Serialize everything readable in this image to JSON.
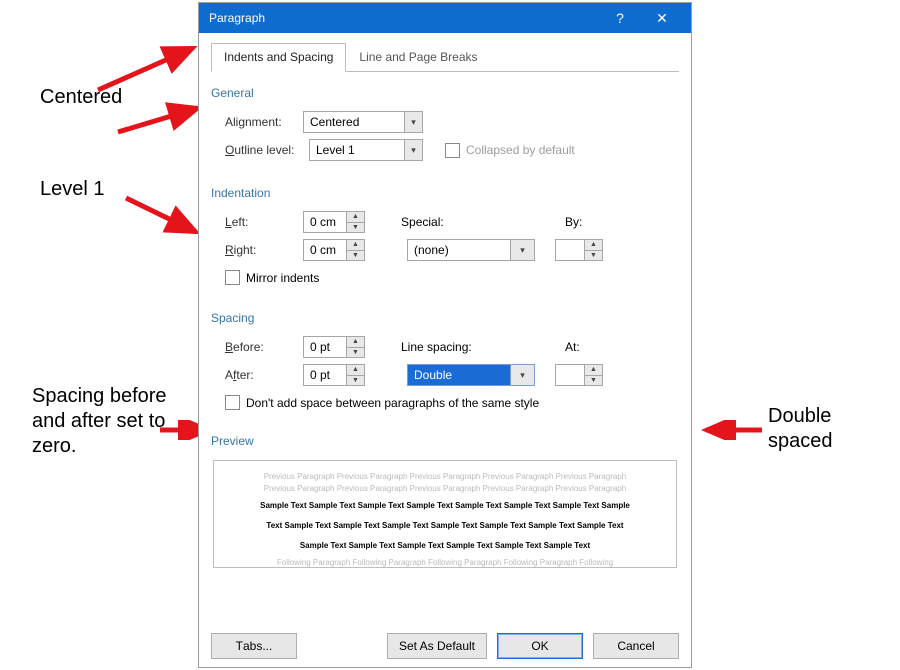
{
  "dialog": {
    "title": "Paragraph",
    "help_icon": "?",
    "close_icon": "✕"
  },
  "tabs": {
    "active": "Indents and Spacing",
    "other": "Line and Page Breaks"
  },
  "general": {
    "section": "General",
    "alignment_label": "Alignment:",
    "alignment_value": "Centered",
    "outline_label_pre": "O",
    "outline_label_post": "utline level:",
    "outline_value": "Level 1",
    "collapsed_label": "Collapsed by default"
  },
  "indentation": {
    "section": "Indentation",
    "left_label_pre": "L",
    "left_label_post": "eft:",
    "left_value": "0 cm",
    "right_label_pre": "R",
    "right_label_post": "ight:",
    "right_value": "0 cm",
    "special_label_pre": "S",
    "special_label_post": "pecial:",
    "special_value": "(none)",
    "by_label_pre": "B",
    "by_label_post": "y:",
    "by_value": "",
    "mirror_label_pre": "M",
    "mirror_label_post": "irror indents"
  },
  "spacing": {
    "section": "Spacing",
    "before_label_pre": "B",
    "before_label_post": "efore:",
    "before_value": "0 pt",
    "after_label_pre": "A",
    "after_label_post": "fter:",
    "after_value": "0 pt",
    "linespacing_label_pre": "Li",
    "linespacing_label_post": "ne spacing:",
    "linespacing_value": "Double",
    "at_label_pre": "A",
    "at_label_post": "t:",
    "at_value": "",
    "dontadd_label": "Don't add space between paragraphs of the same style"
  },
  "preview": {
    "section": "Preview",
    "prev_line": "Previous Paragraph Previous Paragraph Previous Paragraph Previous Paragraph Previous Paragraph",
    "sample1": "Sample Text Sample Text Sample Text Sample Text Sample Text Sample Text Sample Text Sample",
    "sample2": "Text Sample Text Sample Text Sample Text Sample Text Sample Text Sample Text Sample Text",
    "sample3": "Sample Text Sample Text Sample Text Sample Text Sample Text Sample Text",
    "follow_line": "Following Paragraph Following Paragraph Following Paragraph Following Paragraph Following"
  },
  "buttons": {
    "tabs": "Tabs...",
    "default": "Set As Default",
    "ok": "OK",
    "cancel": "Cancel"
  },
  "annotations": {
    "centered": "Centered",
    "level1": "Level 1",
    "spacing_zero": "Spacing before and after set to zero.",
    "double_spaced": "Double spaced"
  }
}
